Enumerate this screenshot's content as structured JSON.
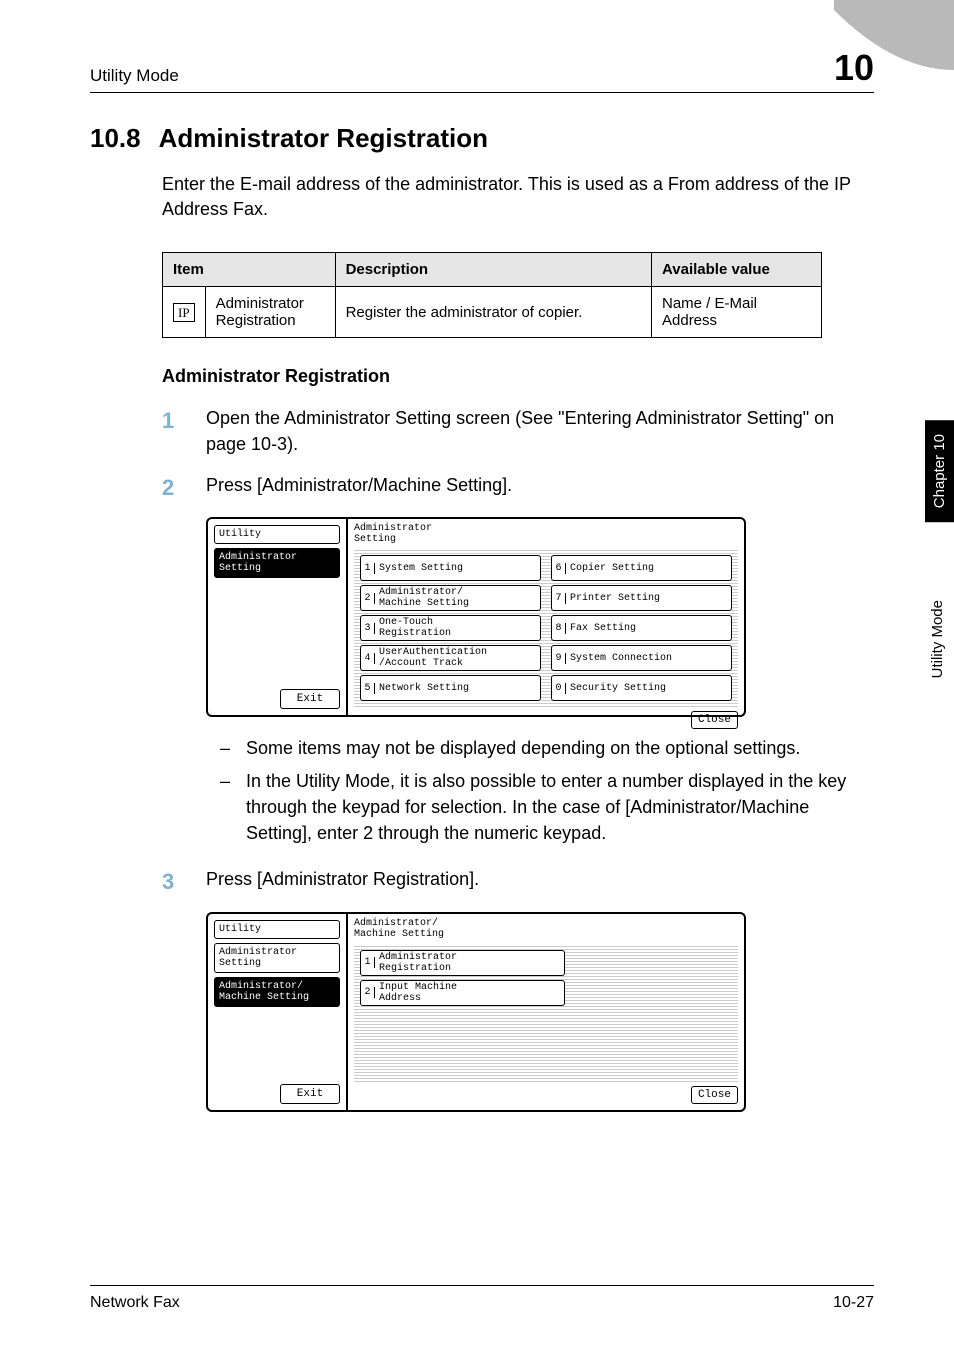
{
  "header": {
    "left": "Utility Mode",
    "right": "10"
  },
  "section": {
    "number": "10.8",
    "title": "Administrator Registration"
  },
  "intro": "Enter the E-mail address of the administrator. This is used as a From address of the IP Address Fax.",
  "table": {
    "headers": {
      "item": "Item",
      "desc": "Description",
      "avail": "Available value"
    },
    "row": {
      "ip": "IP",
      "item": "Administrator Registration",
      "desc": "Register the administrator of copier.",
      "avail": "Name / E-Mail Address"
    }
  },
  "sub_heading": "Administrator Registration",
  "steps": {
    "s1": {
      "n": "1",
      "text": "Open the Administrator Setting screen (See \"Entering Administrator Setting\" on page 10-3)."
    },
    "s2": {
      "n": "2",
      "text": "Press [Administrator/Machine Setting]."
    },
    "s3": {
      "n": "3",
      "text": "Press [Administrator Registration]."
    }
  },
  "screen1": {
    "left_top": "Utility",
    "left_sel": "Administrator\nSetting",
    "exit": "Exit",
    "title": "Administrator\nSetting",
    "buttons": [
      {
        "n": "1",
        "t": "System Setting"
      },
      {
        "n": "6",
        "t": "Copier Setting"
      },
      {
        "n": "2",
        "t": "Administrator/\nMachine Setting"
      },
      {
        "n": "7",
        "t": "Printer Setting"
      },
      {
        "n": "3",
        "t": "One-Touch\nRegistration"
      },
      {
        "n": "8",
        "t": "Fax Setting"
      },
      {
        "n": "4",
        "t": "UserAuthentication\n/Account Track"
      },
      {
        "n": "9",
        "t": "System Connection"
      },
      {
        "n": "5",
        "t": "Network Setting"
      },
      {
        "n": "0",
        "t": "Security Setting"
      }
    ],
    "close": "Close"
  },
  "notes": {
    "n1": "Some items may not be displayed depending on the optional settings.",
    "n2": "In the Utility Mode, it is also possible to enter a number displayed in the key through the keypad for selection. In the case of [Administrator/Machine Setting], enter 2 through the numeric keypad."
  },
  "screen2": {
    "left_top": "Utility",
    "left_mid": "Administrator\nSetting",
    "left_sel": "Administrator/\nMachine Setting",
    "exit": "Exit",
    "title": "Administrator/\nMachine Setting",
    "buttons": [
      {
        "n": "1",
        "t": "Administrator\nRegistration"
      },
      {
        "n": "2",
        "t": "Input Machine\nAddress"
      }
    ],
    "close": "Close"
  },
  "side": {
    "chapter": "Chapter 10",
    "label": "Utility Mode"
  },
  "footer": {
    "left": "Network Fax",
    "right": "10-27"
  }
}
